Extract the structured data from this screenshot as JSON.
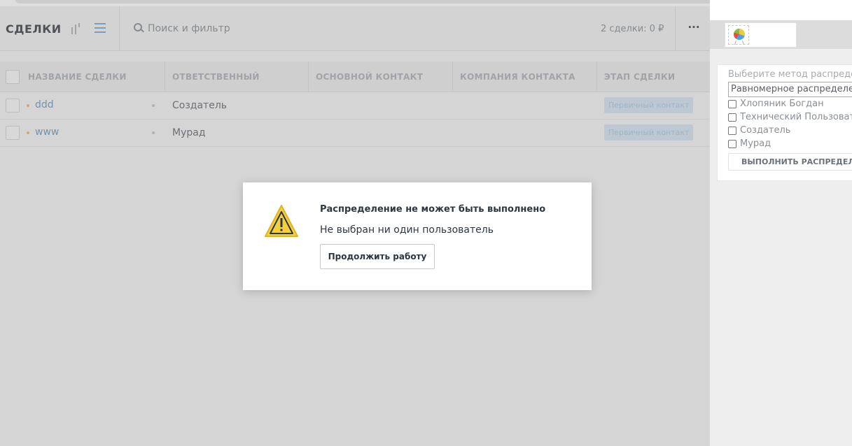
{
  "header": {
    "title": "СДЕЛКИ",
    "search_placeholder": "Поиск и фильтр",
    "deals_count": "2 сделки: 0 ₽",
    "more_label": "···"
  },
  "table": {
    "columns": [
      "НАЗВАНИЕ СДЕЛКИ",
      "ОТВЕТСТВЕННЫЙ",
      "ОСНОВНОЙ КОНТАКТ",
      "КОМПАНИЯ КОНТАКТА",
      "ЭТАП СДЕЛКИ"
    ],
    "rows": [
      {
        "name": "ddd",
        "responsible": "Создатель",
        "stage": "Первичный контакт"
      },
      {
        "name": "www",
        "responsible": "Мурад",
        "stage": "Первичный контакт"
      }
    ]
  },
  "modal": {
    "title": "Распределение не может быть выполнено",
    "message": "Не выбран ни один пользователь",
    "button_label": "Продолжить работу"
  },
  "widget": {
    "method_label": "Выберите метод распределения",
    "method_value": "Равномерное распределение",
    "users": [
      "Хлопяник Богдан",
      "Технический Пользователь",
      "Создатель",
      "Мурад"
    ],
    "run_button_label": "ВЫПОЛНИТЬ РАСПРЕДЕЛЕНИЕ"
  },
  "colors": {
    "warning": "#f4d03f",
    "link": "#86a8c7",
    "stage_badge": "#d9e6f2"
  }
}
